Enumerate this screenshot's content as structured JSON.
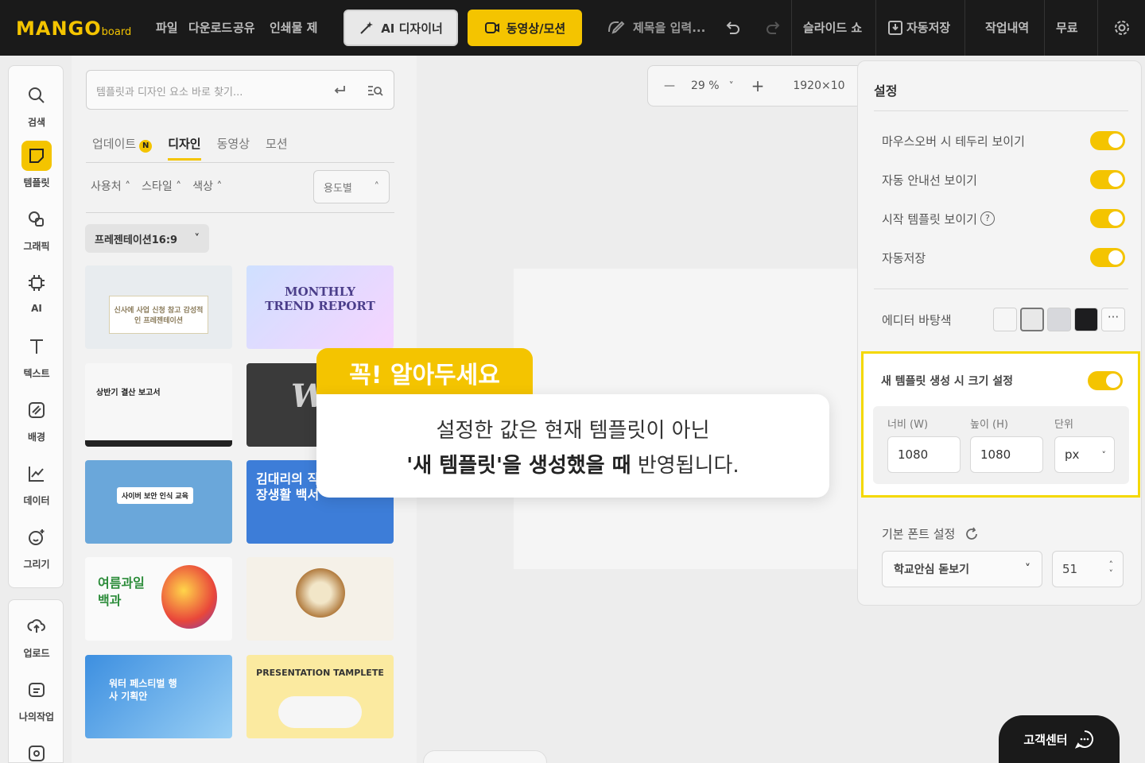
{
  "topbar": {
    "logo_main": "MANGO",
    "logo_sub": "board",
    "menu": [
      "파일",
      "다운로드",
      "공유",
      "인쇄물 제"
    ],
    "ai_button": "AI 디자이너",
    "video_button": "동영상/모션",
    "title_placeholder": "제목을 입력...",
    "slideshow": "슬라이드 쇼",
    "autosave": "자동저장",
    "history": "작업내역",
    "plan": "무료"
  },
  "rail": {
    "items": [
      "검색",
      "템플릿",
      "그래픽",
      "AI",
      "텍스트",
      "배경",
      "데이터",
      "그리기"
    ],
    "bottom_items": [
      "업로드",
      "나의작업"
    ]
  },
  "panel": {
    "search_placeholder": "템플릿과 디자인 요소 바로 찾기...",
    "tabs": [
      "업데이트",
      "디자인",
      "동영상",
      "모션"
    ],
    "update_badge": "N",
    "filters": [
      "사용처",
      "스타일",
      "색상"
    ],
    "use_select": "용도별",
    "ratio_select": "프레젠테이션16:9",
    "thumbnails": [
      {
        "text": "신사에 사업 신청 참고 감성적인 프레젠테이션",
        "bg": "#e8ecef"
      },
      {
        "text": "MONTHLY TREND REPORT",
        "bg": "#dfe6f5"
      },
      {
        "text": "상반기 결산 보고서",
        "bg": "#f7f7f7"
      },
      {
        "text": "We",
        "bg": "#3a3a3a"
      },
      {
        "text": "사이버 보안 인식 교육",
        "bg": "#6aa7da"
      },
      {
        "text": "김대리의 직장생활 백서",
        "bg": "#3d7dd8"
      },
      {
        "text": "여름과일 백과",
        "bg": "#fafafa"
      },
      {
        "text": "",
        "bg": "#f5f1e8"
      },
      {
        "text": "워터 페스티벌 행사 기획안",
        "bg": "#5aa8e6"
      },
      {
        "text": "PRESENTATION TAMPLETE",
        "bg": "#fbeaa0"
      }
    ]
  },
  "zoom": {
    "value": "29 %",
    "size": "1920×10"
  },
  "settings": {
    "title": "설정",
    "rows": [
      {
        "label": "마우스오버 시 테두리 보이기",
        "on": true
      },
      {
        "label": "자동 안내선 보이기",
        "on": true
      },
      {
        "label": "시작 템플릿 보이기",
        "on": true
      },
      {
        "label": "자동저장",
        "on": true
      }
    ],
    "bg_color_label": "에디터 바탕색",
    "swatches": [
      "#f6f6f6",
      "#e8e8e8",
      "#d7d8dc",
      "#1d1d1f"
    ],
    "new_template_label": "새 템플릿 생성 시 크기 설정",
    "width_label": "너비 (W)",
    "height_label": "높이 (H)",
    "unit_label": "단위",
    "width_value": "1080",
    "height_value": "1080",
    "unit_value": "px",
    "font_label": "기본 폰트 설정",
    "font_value": "학교안심 돋보기",
    "font_size": "51"
  },
  "notice": {
    "tag": "꼭! 알아두세요",
    "line1": "설정한 값은 현재 템플릿이 아닌",
    "line2_bold": "'새 템플릿'을 생성했을 때",
    "line2_rest": " 반영됩니다."
  },
  "help": {
    "label": "고객센터"
  },
  "colors": {
    "accent": "#f4c400",
    "topbar": "#1a1a1a"
  }
}
